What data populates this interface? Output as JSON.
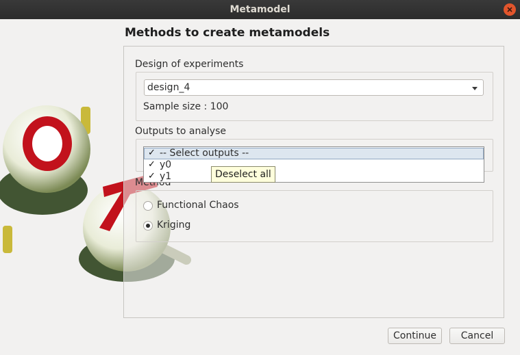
{
  "window": {
    "title": "Metamodel"
  },
  "page": {
    "title": "Methods to create metamodels"
  },
  "doe": {
    "group_label": "Design of experiments",
    "selected_design": "design_4",
    "sample_size_text": "Sample size : 100"
  },
  "outputs": {
    "group_label": "Outputs to analyse",
    "items": [
      {
        "label": "-- Select outputs --",
        "checked": true
      },
      {
        "label": "y0",
        "checked": true
      },
      {
        "label": "y1",
        "checked": true
      }
    ],
    "tooltip": "Deselect all"
  },
  "method": {
    "group_label": "Method",
    "options": [
      {
        "label": "Functional Chaos",
        "selected": false
      },
      {
        "label": "Kriging",
        "selected": true
      }
    ]
  },
  "buttons": {
    "continue": "Continue",
    "cancel": "Cancel"
  },
  "colors": {
    "titlebar": "#2c2c2c",
    "close": "#e2552c",
    "list_highlight": "#dde6ef",
    "tooltip": "#ffffdc"
  }
}
